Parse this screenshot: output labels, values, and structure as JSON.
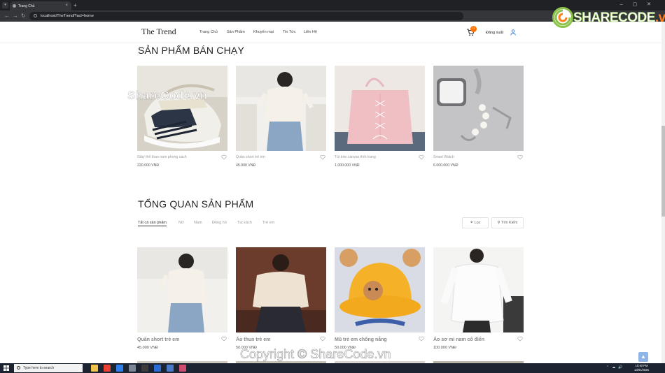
{
  "browser": {
    "tab_title": "Trang Chủ",
    "url": "localhost/TheTrend/?act=home",
    "new_tab": "+",
    "close_tab": "×"
  },
  "site": {
    "brand": "The Trend",
    "menu": [
      "Trang Chủ",
      "Sản Phẩm",
      "Khuyến mại",
      "Tin Tức",
      "Liên Hệ"
    ],
    "cart_count": "0",
    "logout": "Đăng xuất"
  },
  "watermark": {
    "logo_text": "SHARECODE",
    "logo_suffix": ".vn",
    "overlay": "ShareCode.vn",
    "copyright": "Copyright © ShareCode.vn"
  },
  "bestsellers": {
    "title": "SẢN PHẨM BÁN CHẠY",
    "products": [
      {
        "name": "Giày thể thao nam phong cách",
        "price": "220.000 VNĐ"
      },
      {
        "name": "Quần short trẻ em",
        "price": "45.000 VNĐ"
      },
      {
        "name": "Túi tote canvas thời trang",
        "price": "1.000.000 VNĐ"
      },
      {
        "name": "Smart Watch",
        "price": "6.000.000 VNĐ"
      }
    ]
  },
  "overview": {
    "title": "TỔNG QUAN SẢN PHẨM",
    "filters": [
      "Tất cả sản phẩm",
      "Nữ",
      "Nam",
      "Đồng hồ",
      "Túi xách",
      "Trẻ em"
    ],
    "filter_button": "Lọc",
    "search_button": "Tìm Kiếm",
    "products": [
      {
        "name": "Quần short trẻ em",
        "price": "45.000 VNĐ"
      },
      {
        "name": "Áo thun trẻ em",
        "price": "50.000 VNĐ"
      },
      {
        "name": "Mũ trẻ em chống nắng",
        "price": "50.000 VNĐ"
      },
      {
        "name": "Áo sơ mi nam cổ điển",
        "price": "100.000 VNĐ"
      }
    ]
  },
  "taskbar": {
    "search_placeholder": "Type here to search",
    "time": "10:40 PM",
    "date": "13/01/2025"
  },
  "colors": {
    "accent": "#ff6f00",
    "brand_green": "#8bc34a"
  }
}
